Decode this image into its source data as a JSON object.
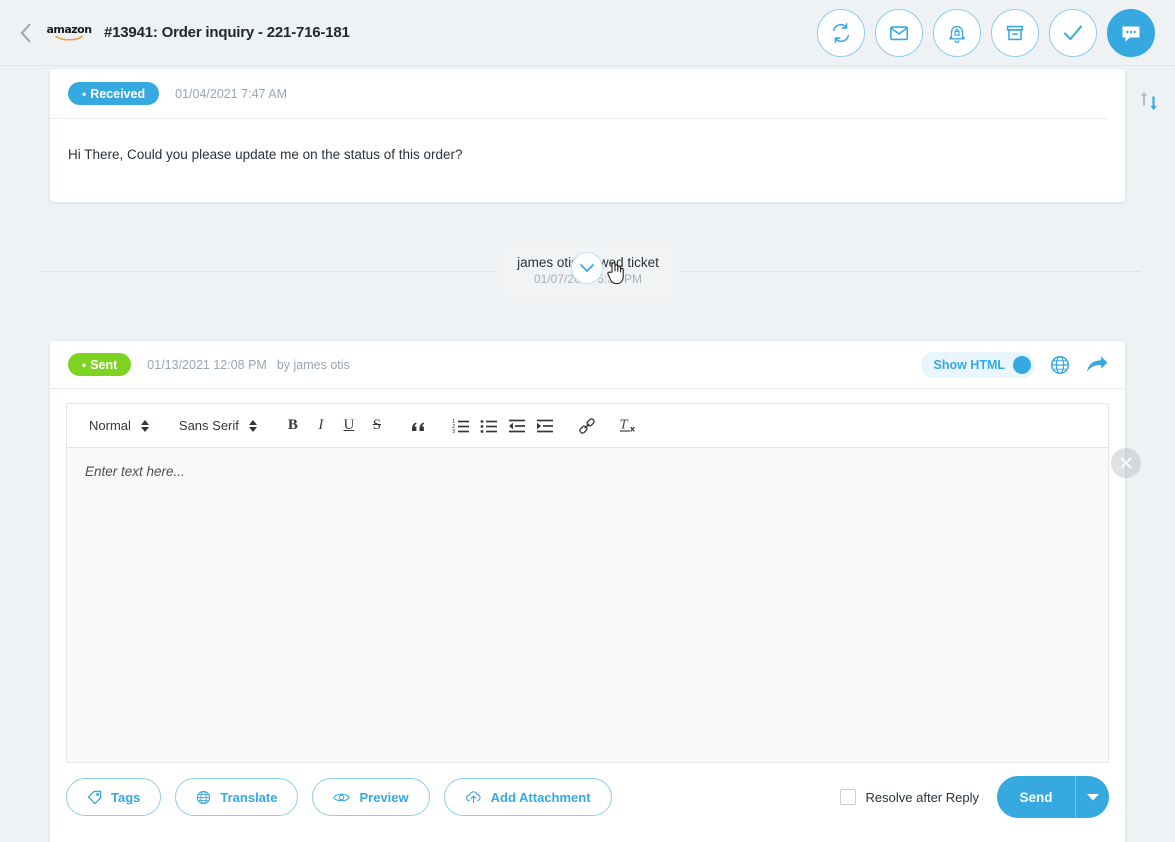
{
  "header": {
    "back_icon": "chevron-left-icon",
    "brand_logo": "amazon-logo",
    "brand_text": "amazon",
    "title": "#13941: Order inquiry - 221-716-181",
    "actions": [
      {
        "name": "refresh-button",
        "icon": "refresh-icon",
        "filled": false
      },
      {
        "name": "email-button",
        "icon": "envelope-icon",
        "filled": false
      },
      {
        "name": "notify-button",
        "icon": "bell-lock-icon",
        "filled": false
      },
      {
        "name": "archive-button",
        "icon": "archive-icon",
        "filled": false
      },
      {
        "name": "resolve-button",
        "icon": "check-icon",
        "filled": false
      },
      {
        "name": "chat-button",
        "icon": "chat-bubble-icon",
        "filled": true
      }
    ]
  },
  "sort_icon": "sort-order-icon",
  "messages": {
    "received": {
      "status_label": "Received",
      "status_dot": "•",
      "timestamp": "01/04/2021 7:47 AM",
      "body": "Hi There, Could you please update me on the status of this order?",
      "expand_icon": "chevron-down-icon"
    },
    "event": {
      "text": "james otis viewed ticket",
      "timestamp": "01/07/2021 5:34 PM"
    },
    "sent": {
      "status_label": "Sent",
      "status_dot": "•",
      "timestamp": "01/13/2021 12:08 PM",
      "author": "by james otis",
      "show_html_label": "Show HTML",
      "show_html_on": true,
      "globe_icon": "globe-icon",
      "forward_icon": "forward-arrow-icon",
      "close_icon": "close-icon"
    }
  },
  "editor": {
    "block_format": "Normal",
    "font_family": "Sans Serif",
    "placeholder": "Enter text here...",
    "tools": [
      {
        "name": "bold-button",
        "label": "B"
      },
      {
        "name": "italic-button",
        "label": "I"
      },
      {
        "name": "underline-button",
        "label": "U"
      },
      {
        "name": "strikethrough-button",
        "label": "S"
      },
      {
        "name": "blockquote-button",
        "label": "”"
      },
      {
        "name": "ordered-list-button",
        "label": "ordered-list-icon"
      },
      {
        "name": "bullet-list-button",
        "label": "bullet-list-icon"
      },
      {
        "name": "outdent-button",
        "label": "outdent-icon"
      },
      {
        "name": "indent-button",
        "label": "indent-icon"
      },
      {
        "name": "link-button",
        "label": "link-icon"
      },
      {
        "name": "clear-format-button",
        "label": "clear-format-icon"
      }
    ]
  },
  "footer": {
    "buttons": [
      {
        "name": "tags-button",
        "label": "Tags",
        "icon": "tag-icon"
      },
      {
        "name": "translate-button",
        "label": "Translate",
        "icon": "globe-icon"
      },
      {
        "name": "preview-button",
        "label": "Preview",
        "icon": "eye-icon"
      },
      {
        "name": "add-attachment-button",
        "label": "Add Attachment",
        "icon": "upload-cloud-icon"
      }
    ],
    "resolve_checkbox_label": "Resolve after Reply",
    "resolve_checked": false,
    "send_label": "Send",
    "send_caret_icon": "caret-down-icon"
  },
  "colors": {
    "accent": "#36a9e1",
    "sent_green": "#7ed321",
    "page_bg": "#eef2f5"
  }
}
